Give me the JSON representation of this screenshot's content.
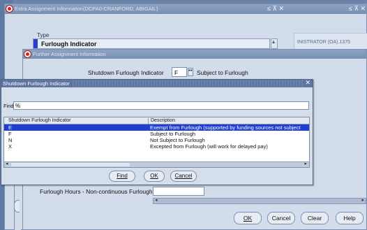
{
  "extra_window": {
    "title": "Extra Assignment Information(DCPA0-CRANFORD, ABIGAIL)",
    "controls_left": "≤ ⊼ ✕",
    "controls_right": "≤ ⊼ ✕",
    "type_label": "Type",
    "type_value": "Furlough Indicator",
    "admin_text": "INISTRATOR (OA).1375"
  },
  "further_window": {
    "title": "Further Assignment Information",
    "shutdown_label": "Shutdown Furlough Indicator",
    "shutdown_value": "F",
    "shutdown_description": "Subject to Furlough",
    "furlough_hours_label": "Furlough Hours - Non-continuous Furlough",
    "furlough_hours_value": "",
    "buttons": {
      "ok": "OK",
      "cancel": "Cancel",
      "clear": "Clear",
      "help": "Help"
    }
  },
  "lov_dialog": {
    "title": "Shutdown Furlough Indicator",
    "find_label": "Find",
    "find_value": "%",
    "columns": [
      "Shutdown Furlough Indicator",
      "Description"
    ],
    "rows": [
      {
        "code": "E",
        "description": "Exempt from Furlough (supported by funding sources not subject",
        "selected": true
      },
      {
        "code": "F",
        "description": "Subject to Furlough",
        "selected": false
      },
      {
        "code": "N",
        "description": "Not Subject to Furlough",
        "selected": false
      },
      {
        "code": "X",
        "description": "Excepted from Furlough (will work for delayed pay)",
        "selected": false
      }
    ],
    "buttons": {
      "find": "Find",
      "ok": "OK",
      "cancel": "Cancel"
    }
  },
  "colors": {
    "selection": "#1f3fd0",
    "titlebar": "#7890b3",
    "oracle_red": "#d61f1f"
  }
}
